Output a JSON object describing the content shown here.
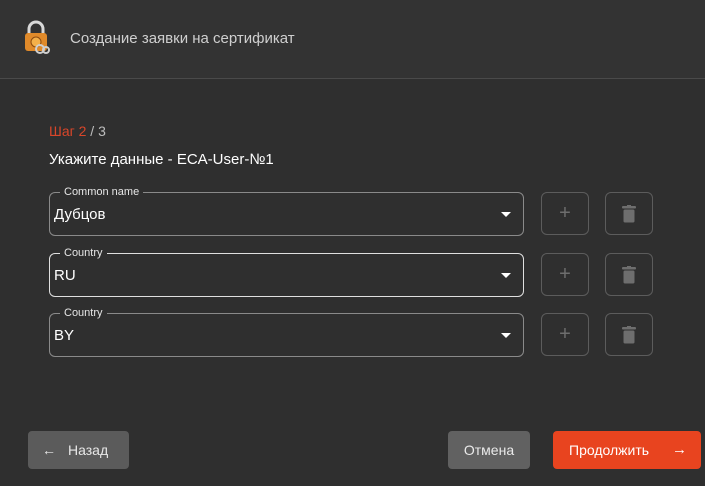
{
  "header": {
    "title": "Создание заявки на сертификат",
    "icon": "lock-certificate-icon"
  },
  "wizard": {
    "step_current": "Шаг 2",
    "step_total": " / 3",
    "subtitle": "Укажите данные - ECA-User-№1"
  },
  "fields": [
    {
      "label": "Common name",
      "value": "Дубцов"
    },
    {
      "label": "Country",
      "value": "RU"
    },
    {
      "label": "Country",
      "value": "BY"
    }
  ],
  "buttons": {
    "add_glyph": "+",
    "back": "Назад",
    "back_arrow": "←",
    "cancel": "Отмена",
    "next": "Продолжить",
    "next_arrow": "→"
  },
  "colors": {
    "accent": "#e8441f",
    "step_accent": "#d9462a",
    "background": "#2f2f2f"
  }
}
